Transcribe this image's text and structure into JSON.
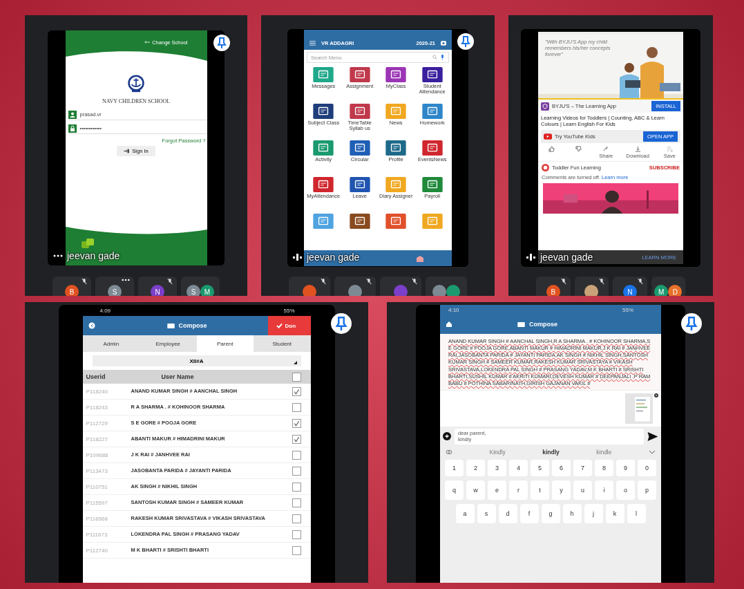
{
  "login_panel": {
    "change_school": "Change School",
    "school_name": "NAVY CHILDREN SCHOOL",
    "username": "prasad.vr",
    "password": "••••••••••••",
    "forgot_password": "Forgot Password ?",
    "sign_in": "Sign In",
    "speaker": {
      "name": "jeevan gade",
      "kind": "dots"
    },
    "participants": [
      {
        "muted": true,
        "options_shown": false,
        "avatars": [
          {
            "initial": "B",
            "color": "#e0521f"
          }
        ]
      },
      {
        "muted": false,
        "options_shown": true,
        "avatars": [
          {
            "initial": "S",
            "color": "#7d8a94"
          }
        ]
      },
      {
        "muted": true,
        "options_shown": false,
        "avatars": [
          {
            "initial": "N",
            "color": "#7b3fc9"
          }
        ]
      },
      {
        "muted": false,
        "options_shown": false,
        "avatars": [
          {
            "initial": "S",
            "color": "#7d8a94"
          },
          {
            "initial": "M",
            "color": "#1a9a6e"
          }
        ]
      }
    ]
  },
  "menu_panel": {
    "school": "VR ADDAGRI",
    "session": "2020-21",
    "search_placeholder": "Search Menu",
    "speaker": {
      "name": "jeevan gade",
      "kind": "bars"
    },
    "items": [
      {
        "label": "Messages",
        "color": "#20a88a"
      },
      {
        "label": "Assignment",
        "color": "#c0394b"
      },
      {
        "label": "MyClass",
        "color": "#9b35b5"
      },
      {
        "label": "Student Attendance",
        "color": "#3a1f9e"
      },
      {
        "label": "Subject Class",
        "color": "#1f3d7a"
      },
      {
        "label": "TimeTable Syllab us",
        "color": "#c0394b"
      },
      {
        "label": "News",
        "color": "#f0a820"
      },
      {
        "label": "Homework",
        "color": "#2f86c9"
      },
      {
        "label": "Activity",
        "color": "#1a9a6e"
      },
      {
        "label": "Circular",
        "color": "#1f5fb5"
      },
      {
        "label": "Profile",
        "color": "#1f6a8a"
      },
      {
        "label": "EventsNews",
        "color": "#d0262e"
      },
      {
        "label": "MyAttendance",
        "color": "#d0262e"
      },
      {
        "label": "Leave",
        "color": "#1f55b0"
      },
      {
        "label": "Diary Assigner",
        "color": "#f0a820"
      },
      {
        "label": "Payroll",
        "color": "#1f8a3a"
      },
      {
        "color": "#4fa3e0"
      },
      {
        "color": "#8a4a20"
      },
      {
        "color": "#e0502a"
      },
      {
        "color": "#f0a820"
      }
    ],
    "participants": [
      {
        "muted": true,
        "options_shown": false,
        "avatars": [
          {
            "color": "#e0521f"
          }
        ]
      },
      {
        "muted": true,
        "options_shown": false,
        "avatars": [
          {
            "color": "#7d8a94"
          }
        ]
      },
      {
        "muted": true,
        "options_shown": false,
        "avatars": [
          {
            "color": "#7b3fc9"
          }
        ]
      },
      {
        "muted": false,
        "options_shown": false,
        "avatars": [
          {
            "color": "#7d8a94"
          },
          {
            "color": "#1a9a6e"
          }
        ]
      }
    ]
  },
  "video_panel": {
    "ad_quote": "\"With BYJU'S App my child remembers his/her concepts forever\"",
    "app_name": "BYJU'S – The Learning App",
    "install": "INSTALL",
    "video_title": "Learning Videos for Toddlers | Counting, ABC & Learn Colours | Learn English For Kids",
    "kids_promo": "Try YouTube Kids",
    "open_app": "OPEN APP",
    "actions": [
      {
        "kind": "like"
      },
      {
        "kind": "dislike"
      },
      {
        "kind": "share",
        "label": "Share"
      },
      {
        "kind": "download",
        "label": "Download"
      },
      {
        "kind": "save",
        "label": "Save"
      }
    ],
    "channel": "Toddler Fun Learning",
    "subscribe": "SUBSCRIBE",
    "comments_note": "Comments are turned off.",
    "learn_more_link": "Learn more",
    "learn_more_button": "LEARN MORE",
    "speaker": {
      "name": "jeevan gade",
      "kind": "bars"
    },
    "participants": [
      {
        "muted": true,
        "options_shown": false,
        "avatars": [
          {
            "initial": "B",
            "color": "#e0521f"
          }
        ]
      },
      {
        "muted": true,
        "options_shown": false,
        "avatars": [
          {
            "color": "#c9a27a"
          }
        ]
      },
      {
        "muted": true,
        "options_shown": false,
        "avatars": [
          {
            "initial": "N",
            "color": "#1a73e8"
          }
        ]
      },
      {
        "muted": false,
        "options_shown": false,
        "avatars": [
          {
            "initial": "M",
            "color": "#1a9a6e"
          },
          {
            "initial": "D",
            "color": "#e8712a"
          }
        ]
      }
    ]
  },
  "recipients_panel": {
    "time": "4:09",
    "battery": "55%",
    "title": "Compose",
    "done": "Don",
    "tabs": [
      {
        "label": "Admin",
        "selected": false
      },
      {
        "label": "Employee",
        "selected": false
      },
      {
        "label": "Parent",
        "selected": true
      },
      {
        "label": "Student",
        "selected": false
      }
    ],
    "class": "XII#A",
    "columns": [
      "Userid",
      "User Name"
    ],
    "all_checked": false,
    "rows": [
      {
        "userid": "P118240",
        "name": "ANAND KUMAR SINGH # AANCHAL SINGH",
        "checked": true
      },
      {
        "userid": "P118243",
        "name": "R A SHARMA . # KOHINOOR SHARMA",
        "checked": false
      },
      {
        "userid": "P112729",
        "name": "S E GORE # POOJA GORE",
        "checked": true
      },
      {
        "userid": "P118227",
        "name": "ABANTI MAKUR # HIMADRINI MAKUR",
        "checked": true
      },
      {
        "userid": "P109688",
        "name": "J K RAI # JANHVEE RAI",
        "checked": false
      },
      {
        "userid": "P113473",
        "name": "JASOBANTA PARIDA # JAYANTI PARIDA",
        "checked": false
      },
      {
        "userid": "P110751",
        "name": "AK SINGH # NIKHIL SINGH",
        "checked": false
      },
      {
        "userid": "P115597",
        "name": "SANTOSH KUMAR SINGH # SAMEER KUMAR",
        "checked": false
      },
      {
        "userid": "P116568",
        "name": "RAKESH KUMAR SRIVASTAVA # VIKASH SRIVASTAVA",
        "checked": false
      },
      {
        "userid": "P111673",
        "name": "LOKENDRA PAL SINGH # PRASANG YADAV",
        "checked": false
      },
      {
        "userid": "P112740",
        "name": "M K  BHARTI # SRISHTI BHARTI",
        "checked": false
      }
    ]
  },
  "message_panel": {
    "time": "4:10",
    "battery": "55%",
    "title": "Compose",
    "recipients": "ANAND KUMAR SINGH # AANCHAL SINGH,R A SHARMA . # KOHINOOR SHARMA,S E GORE # POOJA GORE,ABANTI MAKUR # HIMADRINI MAKUR,J K RAI # JANHVEE RAI,JASOBANTA PARIDA # JAYANTI PARIDA,AK SINGH # NIKHIL SINGH,SANTOSH KUMAR SINGH # SAMEER KUMAR,RAKESH KUMAR SRIVASTAYA # VIKASH SRIVASTAVA,LOKENDRA PAL SINGH # PRASANG YADAV,M K  BHARTI # SRISHTI BHARTI,SUSHIL KUMAR # AKRITI KUMARI,DEVESH KUMAR # DEEPANJALI ,P RAM BABU # POTHINA SABARINATH,GIRISH  GAJANAN VAKIL #",
    "message": "dear parent,\nkindly",
    "suggestions": [
      {
        "label": "Kindly",
        "selected": false
      },
      {
        "label": "kindly",
        "selected": true
      },
      {
        "label": "kindle",
        "selected": false
      }
    ],
    "key_rows": [
      [
        "1",
        "2",
        "3",
        "4",
        "5",
        "6",
        "7",
        "8",
        "9",
        "0"
      ],
      [
        "q",
        "w",
        "e",
        "r",
        "t",
        "y",
        "u",
        "i",
        "o",
        "p"
      ],
      [
        "a",
        "s",
        "d",
        "f",
        "g",
        "h",
        "j",
        "k",
        "l"
      ]
    ]
  }
}
